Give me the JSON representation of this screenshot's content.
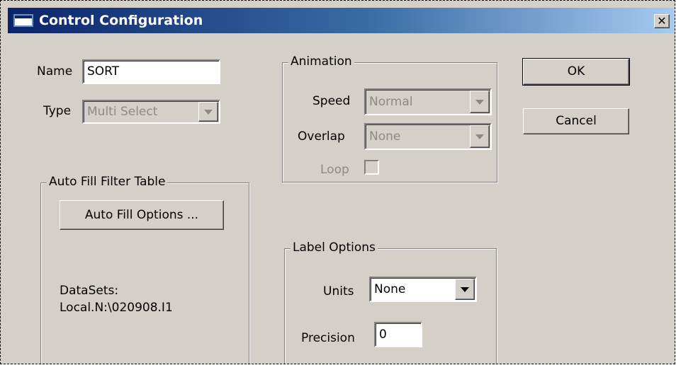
{
  "window": {
    "title": "Control Configuration",
    "close_glyph": "✕"
  },
  "name": {
    "label": "Name",
    "value": "SORT"
  },
  "type": {
    "label": "Type",
    "value": "Multi Select"
  },
  "auto_fill": {
    "group_title": "Auto Fill Filter Table",
    "button_label": "Auto Fill Options ...",
    "datasets_label": "DataSets:",
    "datasets_value": "Local.N:\\020908.I1"
  },
  "animation": {
    "group_title": "Animation",
    "speed_label": "Speed",
    "speed_value": "Normal",
    "overlap_label": "Overlap",
    "overlap_value": "None",
    "loop_label": "Loop",
    "loop_checked": false
  },
  "label_options": {
    "group_title": "Label Options",
    "units_label": "Units",
    "units_value": "None",
    "precision_label": "Precision",
    "precision_value": "0"
  },
  "buttons": {
    "ok": "OK",
    "cancel": "Cancel"
  },
  "icons": [
    "window-icon",
    "close-icon",
    "dropdown-arrow-icon"
  ]
}
